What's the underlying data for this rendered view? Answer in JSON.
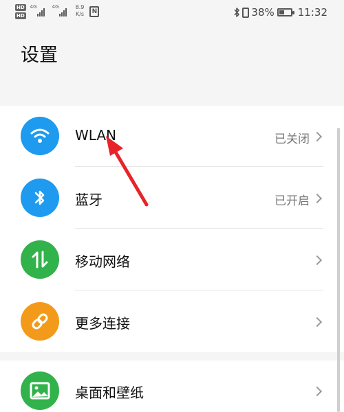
{
  "status_bar": {
    "hd_badges": [
      "HD",
      "HD"
    ],
    "signal_labels": [
      "4G",
      "4G"
    ],
    "speed": "8.9\nK/s",
    "speed_value": "8.9",
    "speed_unit": "K/s",
    "nfc": "N",
    "battery_text": "38%",
    "battery_level": 0.38,
    "time": "11:32"
  },
  "page": {
    "title": "设置"
  },
  "settings": [
    {
      "label": "WLAN",
      "status": "已关闭",
      "icon": "wifi-icon",
      "color": "#1e9bef"
    },
    {
      "label": "蓝牙",
      "status": "已开启",
      "icon": "bluetooth-icon",
      "color": "#1e9bef"
    },
    {
      "label": "移动网络",
      "status": "",
      "icon": "mobile-data-icon",
      "color": "#32b24a"
    },
    {
      "label": "更多连接",
      "status": "",
      "icon": "link-icon",
      "color": "#f39a1a"
    },
    {
      "label": "桌面和壁纸",
      "status": "",
      "icon": "wallpaper-icon",
      "color": "#32b24a"
    }
  ],
  "annotation": {
    "arrow_color": "#e8232a"
  }
}
